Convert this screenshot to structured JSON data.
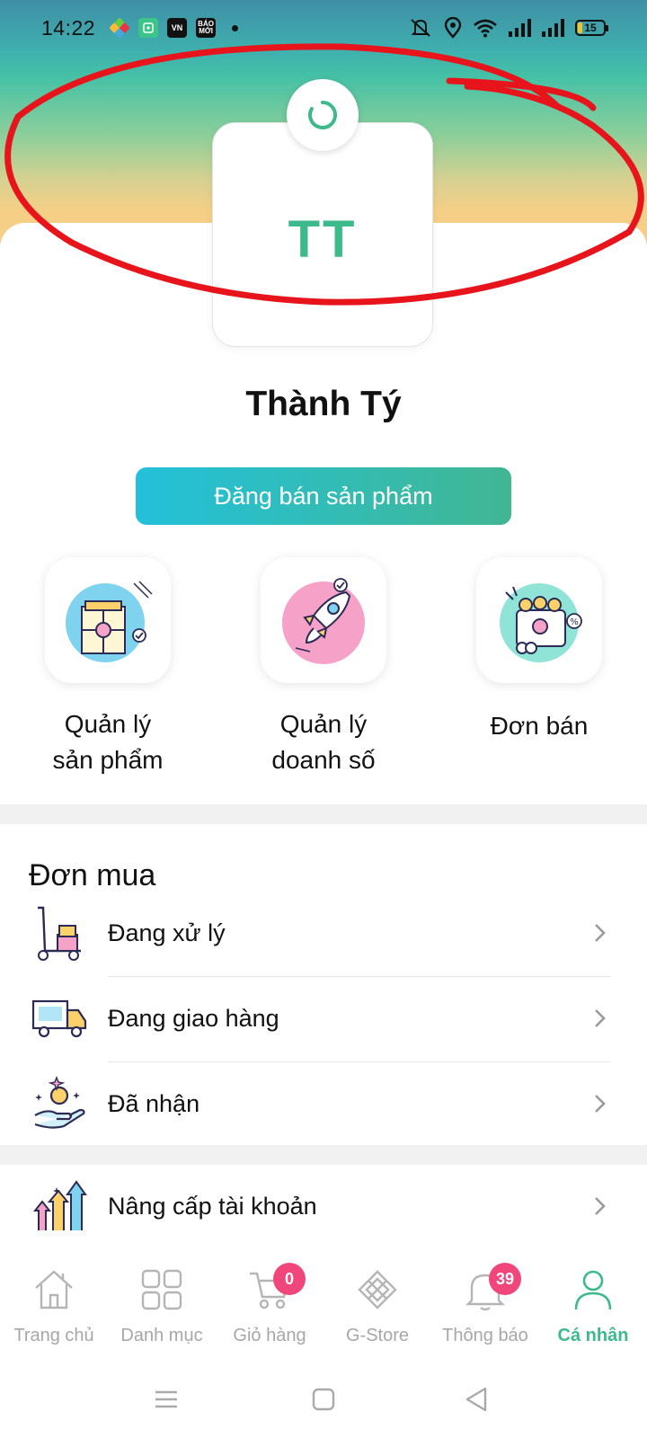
{
  "status_bar": {
    "time": "14:22",
    "battery": "15",
    "app_icons": [
      "colorful-app-icon",
      "green-app-icon",
      "vn-app-icon",
      "bao-moi-app-icon"
    ],
    "app_icon_labels": {
      "vn": "VN",
      "bao_moi": "BÁO MỚI"
    },
    "status_icons": [
      "mute-icon",
      "location-icon",
      "wifi-icon",
      "signal-icon",
      "signal-icon",
      "battery-icon"
    ]
  },
  "profile": {
    "initials": "TT",
    "name": "Thành Tý",
    "sell_button_label": "Đăng bán sản phẩm"
  },
  "shop_tiles": [
    {
      "label_line1": "Quản lý",
      "label_line2": "sản phẩm",
      "icon": "product-management-icon"
    },
    {
      "label_line1": "Quản lý",
      "label_line2": "doanh số",
      "icon": "rocket-sales-icon"
    },
    {
      "label_line1": "Đơn bán",
      "label_line2": "",
      "icon": "sales-orders-icon"
    }
  ],
  "purchase_section": {
    "title": "Đơn mua",
    "items": [
      {
        "label": "Đang xử lý",
        "icon": "hand-truck-icon"
      },
      {
        "label": "Đang giao hàng",
        "icon": "delivery-truck-icon"
      },
      {
        "label": "Đã nhận",
        "icon": "received-coin-hand-icon"
      }
    ]
  },
  "upgrade": {
    "label": "Nâng cấp tài khoản",
    "icon": "upgrade-arrows-icon"
  },
  "bottom_nav": [
    {
      "label": "Trang chủ",
      "icon": "home-icon",
      "badge": ""
    },
    {
      "label": "Danh mục",
      "icon": "grid-icon",
      "badge": ""
    },
    {
      "label": "Giỏ hàng",
      "icon": "cart-icon",
      "badge": "0"
    },
    {
      "label": "G-Store",
      "icon": "g-store-icon",
      "badge": ""
    },
    {
      "label": "Thông báo",
      "icon": "bell-icon",
      "badge": "39"
    },
    {
      "label": "Cá nhân",
      "icon": "person-icon",
      "badge": "",
      "active": true
    }
  ],
  "colors": {
    "accent_green": "#3cba8c",
    "badge_pink": "#f0467c",
    "annotation_red": "#e8141c",
    "button_gradient_start": "#24c0da",
    "button_gradient_end": "#42b692"
  }
}
